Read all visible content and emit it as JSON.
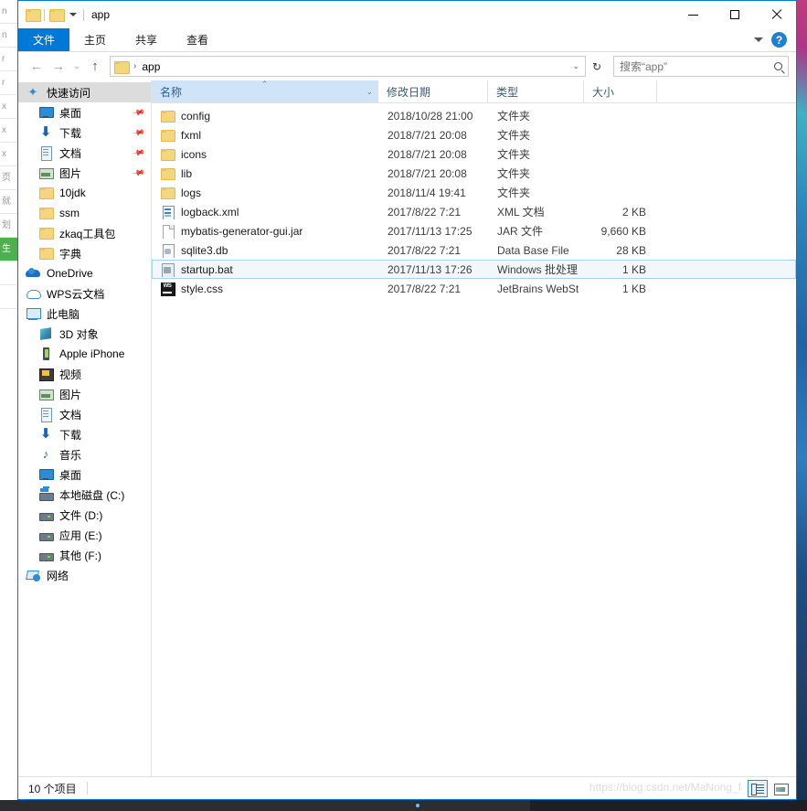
{
  "window": {
    "title": "app",
    "quick_access_icons": [
      "folder-icon",
      "folder-icon",
      "chevron-down-icon"
    ],
    "controls": {
      "minimize": "—",
      "maximize": "□",
      "close": "✕"
    }
  },
  "ribbon": {
    "tabs": [
      {
        "label": "文件",
        "active": true
      },
      {
        "label": "主页",
        "active": false
      },
      {
        "label": "共享",
        "active": false
      },
      {
        "label": "查看",
        "active": false
      }
    ],
    "expand_icon": "chevron-down-icon",
    "help_label": "?"
  },
  "addressbar": {
    "back": "←",
    "forward": "→",
    "recent": "⌄",
    "up": "↑",
    "breadcrumb_icon": "folder-icon",
    "breadcrumb": "app",
    "crumb_arrow": "›",
    "dropdown": "⌄",
    "refresh": "↻"
  },
  "search": {
    "placeholder": "搜索“app”",
    "value": "",
    "icon": "search-icon"
  },
  "sidebar": {
    "items": [
      {
        "label": "快速访问",
        "icon": "star-pin-icon",
        "level": "root",
        "selected": true,
        "pinned": false
      },
      {
        "label": "桌面",
        "icon": "monitor-icon",
        "level": "lvl2",
        "selected": false,
        "pinned": true
      },
      {
        "label": "下载",
        "icon": "download-arrow-icon",
        "level": "lvl2",
        "selected": false,
        "pinned": true
      },
      {
        "label": "文档",
        "icon": "document-icon",
        "level": "lvl2",
        "selected": false,
        "pinned": true
      },
      {
        "label": "图片",
        "icon": "picture-icon",
        "level": "lvl2",
        "selected": false,
        "pinned": true
      },
      {
        "label": "10jdk",
        "icon": "folder-icon",
        "level": "lvl2",
        "selected": false,
        "pinned": false
      },
      {
        "label": "ssm",
        "icon": "folder-icon",
        "level": "lvl2",
        "selected": false,
        "pinned": false
      },
      {
        "label": "zkaq工具包",
        "icon": "folder-icon",
        "level": "lvl2",
        "selected": false,
        "pinned": false
      },
      {
        "label": "字典",
        "icon": "folder-icon",
        "level": "lvl2",
        "selected": false,
        "pinned": false
      },
      {
        "label": "OneDrive",
        "icon": "onedrive-icon",
        "level": "root",
        "selected": false,
        "pinned": false
      },
      {
        "label": "WPS云文档",
        "icon": "wps-cloud-icon",
        "level": "root",
        "selected": false,
        "pinned": false
      },
      {
        "label": "此电脑",
        "icon": "this-pc-icon",
        "level": "root",
        "selected": false,
        "pinned": false
      },
      {
        "label": "3D 对象",
        "icon": "3d-objects-icon",
        "level": "lvl2",
        "selected": false,
        "pinned": false
      },
      {
        "label": "Apple iPhone",
        "icon": "phone-icon",
        "level": "lvl2",
        "selected": false,
        "pinned": false
      },
      {
        "label": "视频",
        "icon": "video-icon",
        "level": "lvl2",
        "selected": false,
        "pinned": false
      },
      {
        "label": "图片",
        "icon": "picture-icon",
        "level": "lvl2",
        "selected": false,
        "pinned": false
      },
      {
        "label": "文档",
        "icon": "document-icon",
        "level": "lvl2",
        "selected": false,
        "pinned": false
      },
      {
        "label": "下载",
        "icon": "download-arrow-icon",
        "level": "lvl2",
        "selected": false,
        "pinned": false
      },
      {
        "label": "音乐",
        "icon": "music-note-icon",
        "level": "lvl2",
        "selected": false,
        "pinned": false
      },
      {
        "label": "桌面",
        "icon": "monitor-icon",
        "level": "lvl2",
        "selected": false,
        "pinned": false
      },
      {
        "label": "本地磁盘 (C:)",
        "icon": "system-drive-icon",
        "level": "lvl2",
        "selected": false,
        "pinned": false
      },
      {
        "label": "文件 (D:)",
        "icon": "drive-icon",
        "level": "lvl2",
        "selected": false,
        "pinned": false
      },
      {
        "label": "应用 (E:)",
        "icon": "drive-icon",
        "level": "lvl2",
        "selected": false,
        "pinned": false
      },
      {
        "label": "其他 (F:)",
        "icon": "drive-icon",
        "level": "lvl2",
        "selected": false,
        "pinned": false
      },
      {
        "label": "网络",
        "icon": "network-icon",
        "level": "root",
        "selected": false,
        "pinned": false
      }
    ]
  },
  "filelist": {
    "columns": [
      {
        "key": "name",
        "label": "名称",
        "sorted": true,
        "sort_caret": "⌃",
        "chevron": "⌄"
      },
      {
        "key": "date",
        "label": "修改日期"
      },
      {
        "key": "type",
        "label": "类型"
      },
      {
        "key": "size",
        "label": "大小"
      }
    ],
    "rows": [
      {
        "name": "config",
        "date": "2018/10/28 21:00",
        "type": "文件夹",
        "size": "",
        "icon": "folder-icon",
        "selected": false
      },
      {
        "name": "fxml",
        "date": "2018/7/21 20:08",
        "type": "文件夹",
        "size": "",
        "icon": "folder-icon",
        "selected": false
      },
      {
        "name": "icons",
        "date": "2018/7/21 20:08",
        "type": "文件夹",
        "size": "",
        "icon": "folder-icon",
        "selected": false
      },
      {
        "name": "lib",
        "date": "2018/7/21 20:08",
        "type": "文件夹",
        "size": "",
        "icon": "folder-icon",
        "selected": false
      },
      {
        "name": "logs",
        "date": "2018/11/4 19:41",
        "type": "文件夹",
        "size": "",
        "icon": "folder-icon",
        "selected": false
      },
      {
        "name": "logback.xml",
        "date": "2017/8/22 7:21",
        "type": "XML 文档",
        "size": "2 KB",
        "icon": "xml-file-icon",
        "selected": false
      },
      {
        "name": "mybatis-generator-gui.jar",
        "date": "2017/11/13 17:25",
        "type": "JAR 文件",
        "size": "9,660 KB",
        "icon": "blank-file-icon",
        "selected": false
      },
      {
        "name": "sqlite3.db",
        "date": "2017/8/22 7:21",
        "type": "Data Base File",
        "size": "28 KB",
        "icon": "database-file-icon",
        "selected": false
      },
      {
        "name": "startup.bat",
        "date": "2017/11/13 17:26",
        "type": "Windows 批处理",
        "size": "1 KB",
        "icon": "batch-file-icon",
        "selected": true
      },
      {
        "name": "style.css",
        "date": "2017/8/22 7:21",
        "type": "JetBrains WebSt",
        "size": "1 KB",
        "icon": "webstorm-file-icon",
        "selected": false
      }
    ]
  },
  "statusbar": {
    "item_count": "10 个项目",
    "watermark": "https://blog.csdn.net/MaNong_f",
    "views": [
      {
        "name": "details-view",
        "active": true
      },
      {
        "name": "large-icons-view",
        "active": false
      }
    ]
  },
  "colors": {
    "accent": "#0078d7",
    "header_bg": "#cfe4f7",
    "selection": "#f2f7fb",
    "folder": "#f5d67f"
  }
}
